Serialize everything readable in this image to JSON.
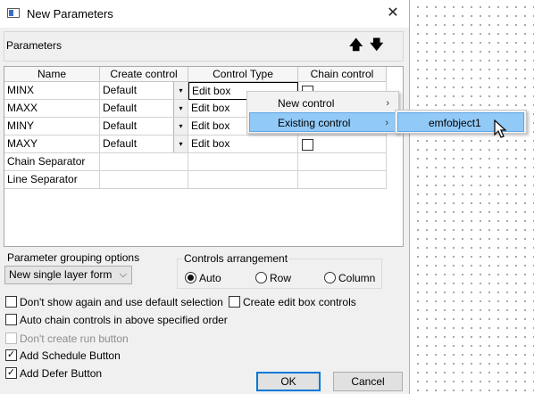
{
  "window": {
    "title": "New Parameters",
    "close_glyph": "✕"
  },
  "parameters_group": {
    "label": "Parameters",
    "move_up": "🡅",
    "move_down": "🡇"
  },
  "table": {
    "columns": [
      "Name",
      "Create control",
      "Control Type",
      "Chain control"
    ],
    "rows": [
      {
        "name": "MINX",
        "create": "Default",
        "type": "Edit box",
        "chain": false
      },
      {
        "name": "MAXX",
        "create": "Default",
        "type": "Edit box",
        "chain": false
      },
      {
        "name": "MINY",
        "create": "Default",
        "type": "Edit box",
        "chain": false
      },
      {
        "name": "MAXY",
        "create": "Default",
        "type": "Edit box",
        "chain": false
      },
      {
        "name": "Chain Separator"
      },
      {
        "name": "Line Separator"
      }
    ],
    "dropdown_glyph": "▾"
  },
  "grouping": {
    "label": "Parameter grouping options",
    "selected": "New single layer form",
    "arrow": "⌵"
  },
  "arrangement": {
    "legend": "Controls arrangement",
    "options": [
      "Auto",
      "Row",
      "Column"
    ],
    "selected": "Auto"
  },
  "options": {
    "dont_show_again": {
      "label": "Don't show again and use default selection",
      "checked": false
    },
    "create_edit_box": {
      "label": "Create edit box controls",
      "checked": false
    },
    "auto_chain": {
      "label": "Auto chain controls in above specified order",
      "checked": false
    },
    "dont_create_run": {
      "label": "Don't create run button",
      "checked": false,
      "disabled": true
    },
    "add_schedule": {
      "label": "Add Schedule Button",
      "checked": true
    },
    "add_defer": {
      "label": "Add Defer Button",
      "checked": true
    },
    "check_glyph": "✓"
  },
  "buttons": {
    "ok": "OK",
    "cancel": "Cancel"
  },
  "context_menu": {
    "items": [
      {
        "label": "New control",
        "arrow": "›"
      },
      {
        "label": "Existing control",
        "arrow": "›"
      }
    ],
    "submenu": {
      "items": [
        "emfobject1"
      ]
    }
  }
}
